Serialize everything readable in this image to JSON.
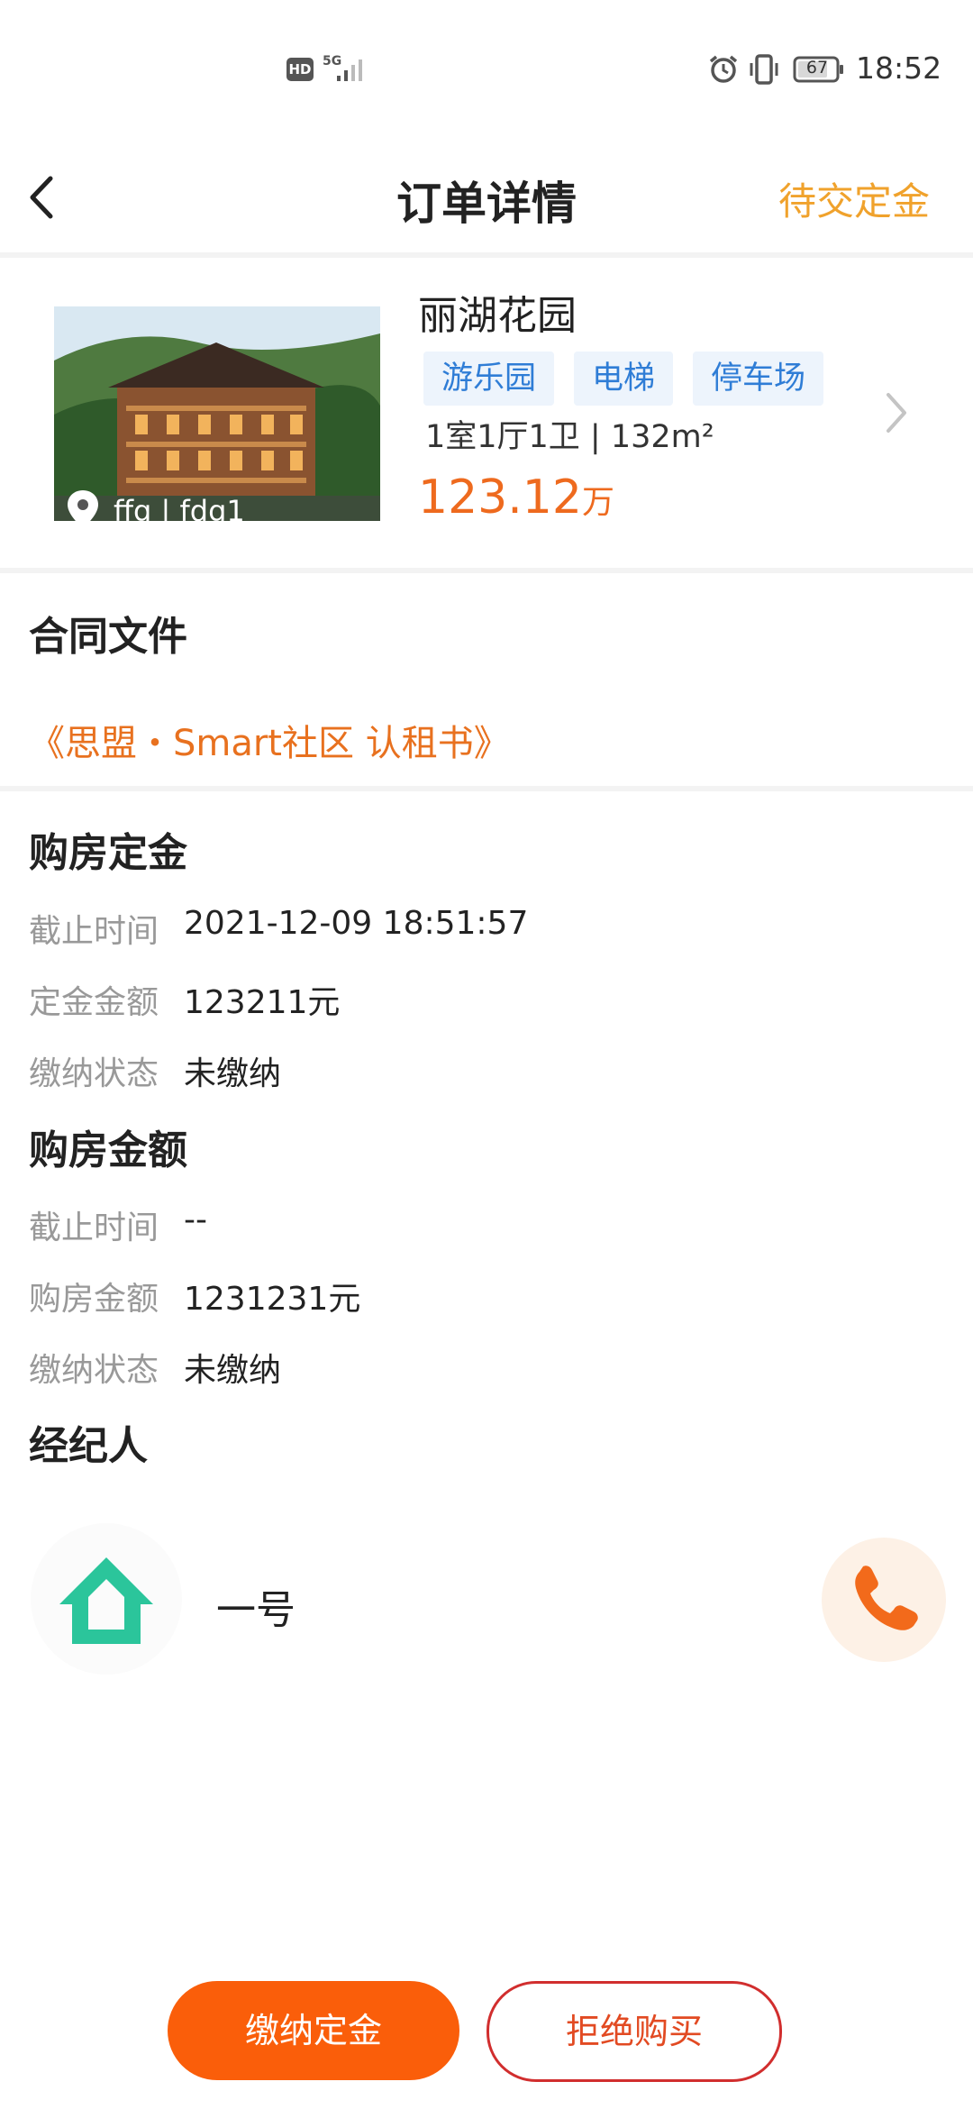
{
  "status_bar": {
    "hd": "HD",
    "network": "5G",
    "battery": "67",
    "time": "18:52"
  },
  "header": {
    "title": "订单详情",
    "status": "待交定金",
    "back_icon": "chevron-left-icon"
  },
  "property": {
    "name": "丽湖花园",
    "tags": [
      "游乐园",
      "电梯",
      "停车场"
    ],
    "layout": "1室1厅1卫 | 132m²",
    "price": "123.12",
    "price_unit": "万",
    "location": "ffg | fdg1"
  },
  "contract": {
    "title": "合同文件",
    "link": "《思盟・Smart社区 认租书》"
  },
  "deposit": {
    "title": "购房定金",
    "rows": [
      {
        "label": "截止时间",
        "value": "2021-12-09 18:51:57"
      },
      {
        "label": "定金金额",
        "value": "123211元"
      },
      {
        "label": "缴纳状态",
        "value": "未缴纳"
      }
    ]
  },
  "payment": {
    "title": "购房金额",
    "rows": [
      {
        "label": "截止时间",
        "value": "--"
      },
      {
        "label": "购房金额",
        "value": "1231231元"
      },
      {
        "label": "缴纳状态",
        "value": "未缴纳"
      }
    ]
  },
  "agent": {
    "title": "经纪人",
    "name": "一号"
  },
  "actions": {
    "pay_deposit": "缴纳定金",
    "reject": "拒绝购买"
  },
  "colors": {
    "accent": "#fa5e0a",
    "status": "#f0a22c",
    "tag_text": "#2f7dd6",
    "avatar_green": "#2bc59b"
  }
}
